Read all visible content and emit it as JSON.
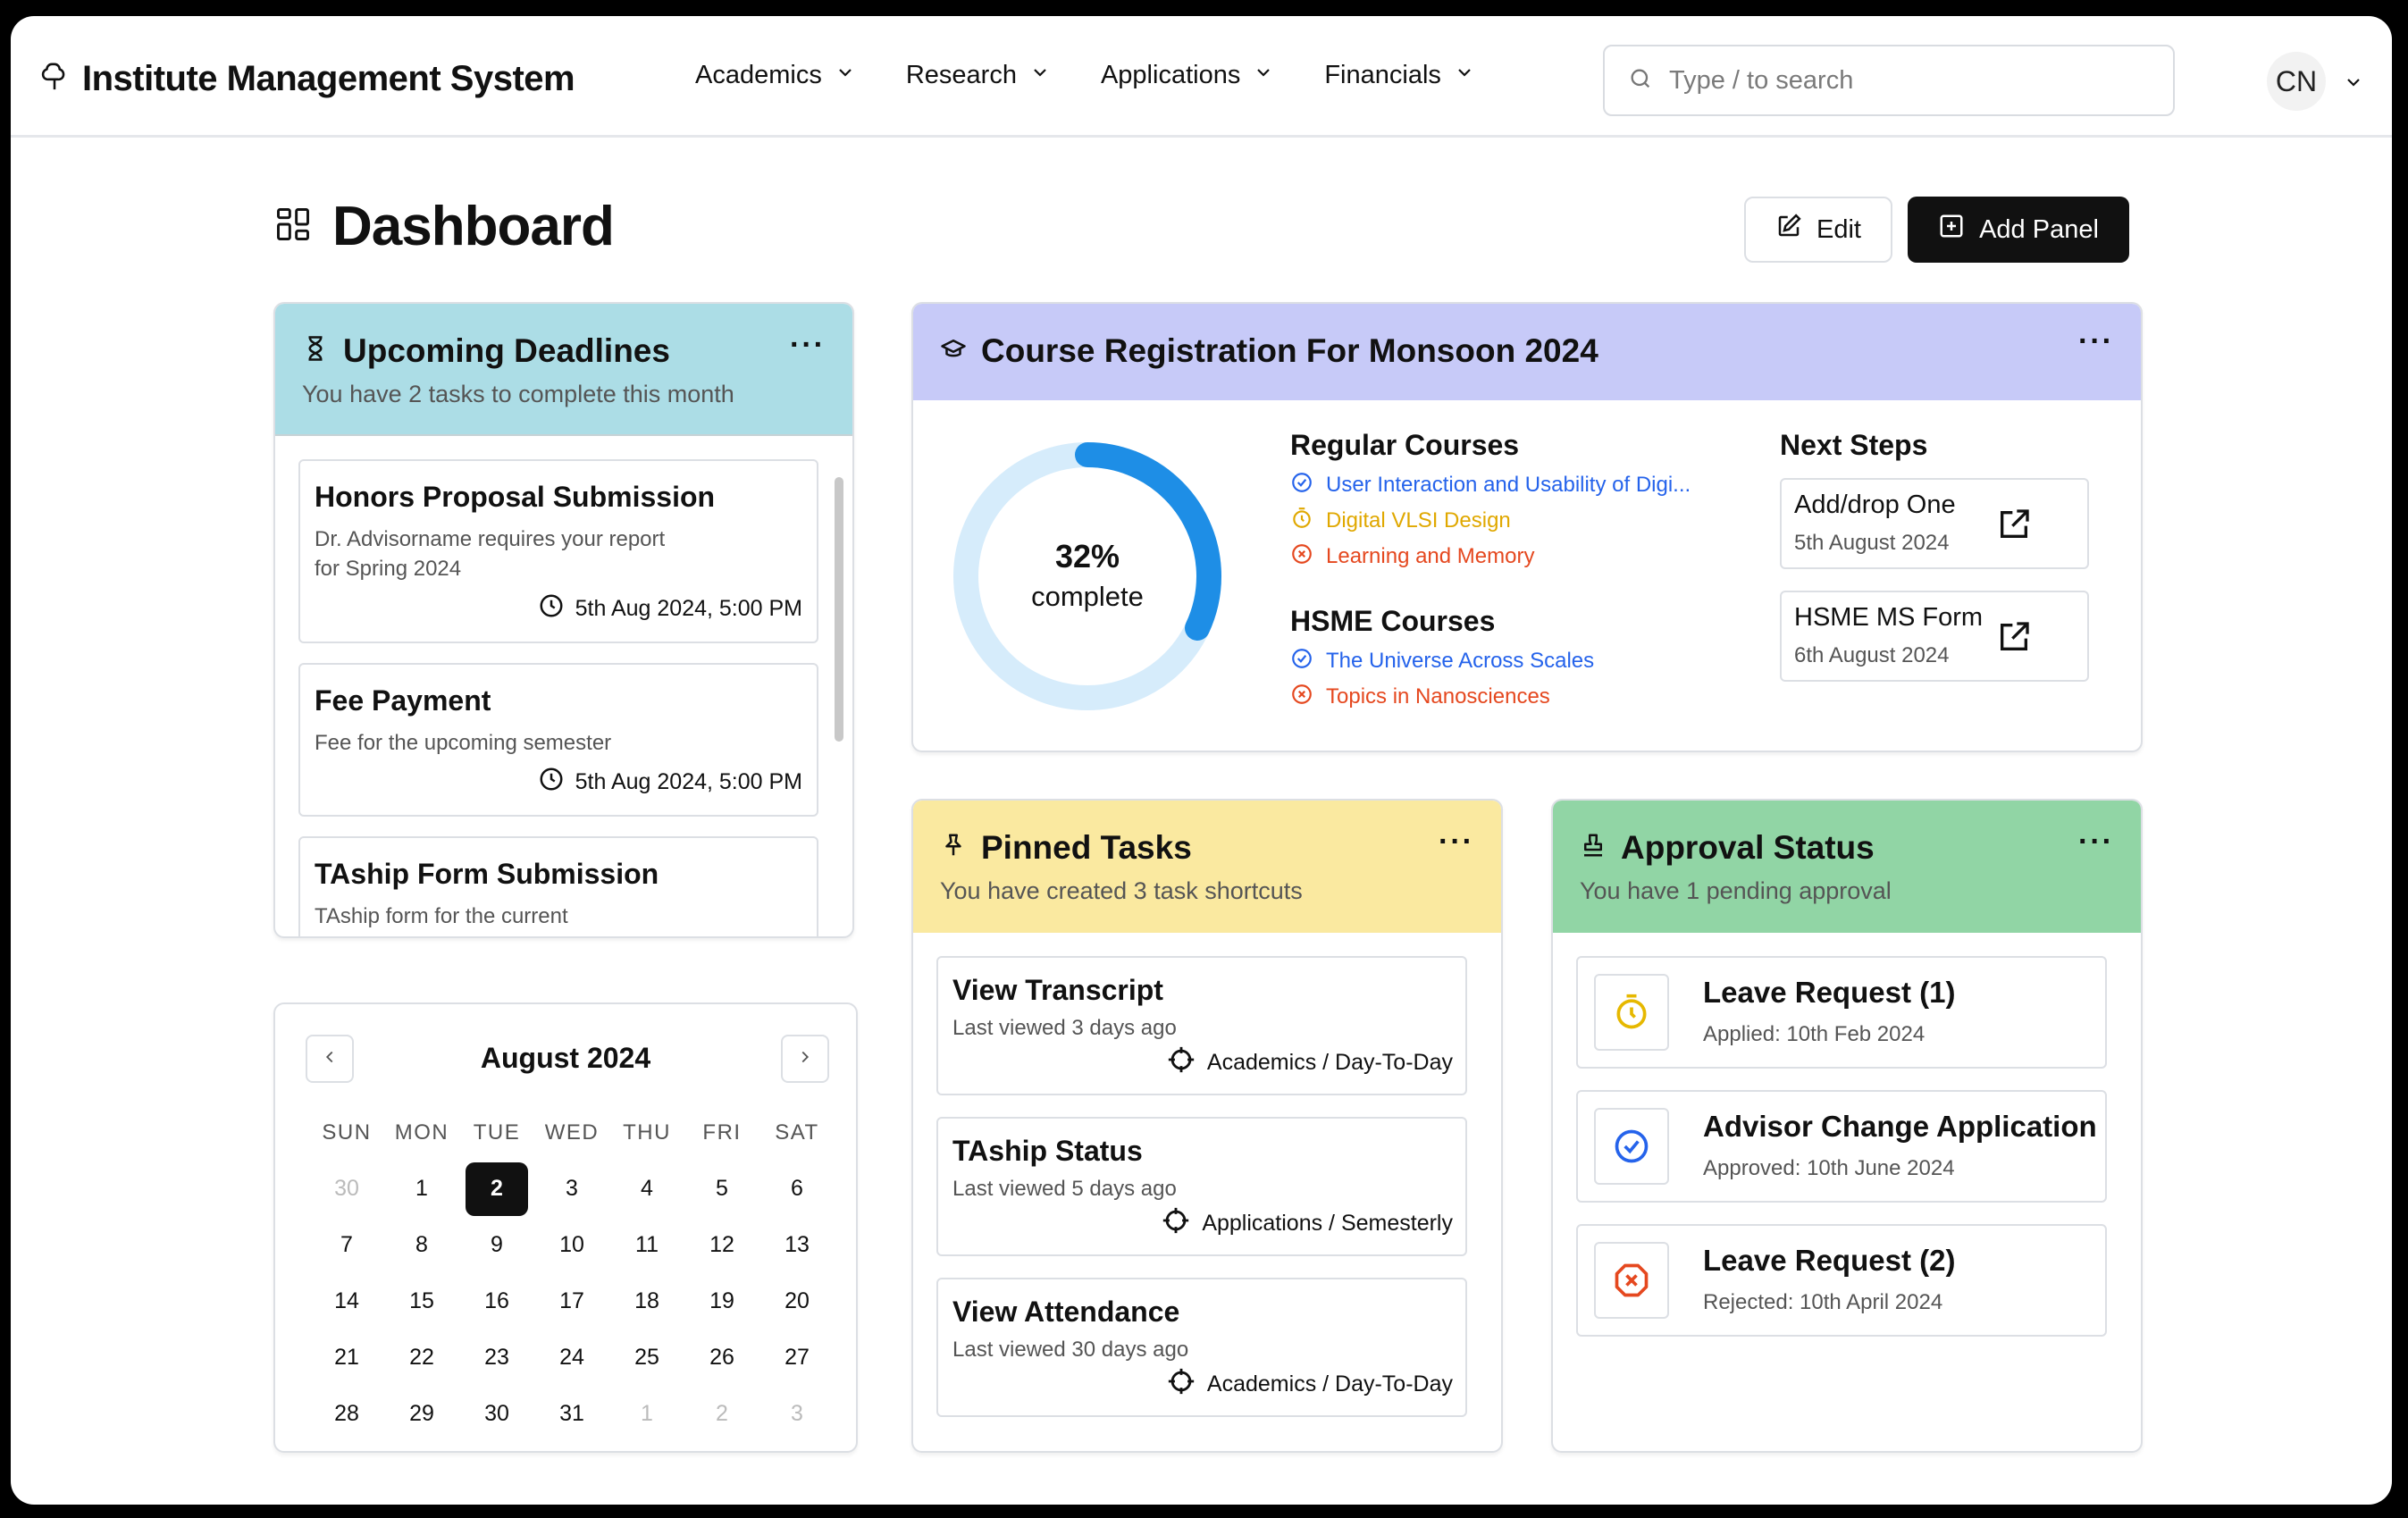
{
  "app": {
    "title": "Institute Management System"
  },
  "nav": {
    "items": [
      {
        "label": "Academics"
      },
      {
        "label": "Research"
      },
      {
        "label": "Applications"
      },
      {
        "label": "Financials"
      }
    ],
    "search_placeholder": "Type / to search",
    "avatar_initials": "CN"
  },
  "page": {
    "title": "Dashboard",
    "edit_label": "Edit",
    "add_panel_label": "Add Panel"
  },
  "deadlines": {
    "title": "Upcoming Deadlines",
    "subtitle": "You have 2 tasks to complete this month",
    "items": [
      {
        "title": "Honors Proposal Submission",
        "desc": "Dr. Advisorname requires your report for Spring 2024",
        "due": "5th Aug 2024, 5:00 PM"
      },
      {
        "title": "Fee Payment",
        "desc": "Fee for the upcoming semester",
        "due": "5th Aug 2024, 5:00 PM"
      },
      {
        "title": "TAship Form Submission",
        "desc": "TAship form for the current",
        "due": ""
      }
    ]
  },
  "calendar": {
    "title": "August 2024",
    "weekdays": [
      "SUN",
      "MON",
      "TUE",
      "WED",
      "THU",
      "FRI",
      "SAT"
    ],
    "weeks": [
      [
        "30",
        "1",
        "2",
        "3",
        "4",
        "5",
        "6"
      ],
      [
        "7",
        "8",
        "9",
        "10",
        "11",
        "12",
        "13"
      ],
      [
        "14",
        "15",
        "16",
        "17",
        "18",
        "19",
        "20"
      ],
      [
        "21",
        "22",
        "23",
        "24",
        "25",
        "26",
        "27"
      ],
      [
        "28",
        "29",
        "30",
        "31",
        "1",
        "2",
        "3"
      ]
    ],
    "selected": "2"
  },
  "course": {
    "title": "Course Registration For Monsoon 2024",
    "progress_percent": 32,
    "progress_label": "32%",
    "progress_text": "complete",
    "regular_title": "Regular Courses",
    "regular": [
      {
        "name": "User Interaction and Usability of Digi...",
        "status": "registered"
      },
      {
        "name": "Digital VLSI Design",
        "status": "pending"
      },
      {
        "name": "Learning and Memory",
        "status": "rejected"
      }
    ],
    "hsme_title": "HSME Courses",
    "hsme": [
      {
        "name": "The Universe Across Scales",
        "status": "registered"
      },
      {
        "name": "Topics in Nanosciences",
        "status": "rejected"
      }
    ],
    "next_title": "Next Steps",
    "next": [
      {
        "title": "Add/drop One",
        "date": "5th August 2024"
      },
      {
        "title": "HSME MS Form",
        "date": "6th August 2024"
      }
    ]
  },
  "pinned": {
    "title": "Pinned Tasks",
    "subtitle": "You have created 3 task shortcuts",
    "items": [
      {
        "title": "View Transcript",
        "desc": "Last viewed 3 days ago",
        "category": "Academics / Day-To-Day"
      },
      {
        "title": "TAship Status",
        "desc": "Last viewed 5 days ago",
        "category": "Applications / Semesterly"
      },
      {
        "title": "View Attendance",
        "desc": "Last viewed 30 days ago",
        "category": "Academics / Day-To-Day"
      }
    ]
  },
  "approval": {
    "title": "Approval Status",
    "subtitle": "You have 1 pending approval",
    "items": [
      {
        "title": "Leave Request (1)",
        "desc": "Applied: 10th Feb 2024",
        "status": "pending"
      },
      {
        "title": "Advisor Change Application",
        "desc": "Approved: 10th June 2024",
        "status": "approved"
      },
      {
        "title": "Leave Request (2)",
        "desc": "Rejected: 10th April 2024",
        "status": "rejected"
      }
    ]
  },
  "colors": {
    "deadlines_header": "#acdde6",
    "course_header": "#c7caf8",
    "pinned_header": "#fae9a0",
    "approval_header": "#91d5a5",
    "registered": "#2563eb",
    "pending": "#e0a800",
    "rejected": "#e5481f",
    "donut_fill": "#1e8ee6",
    "donut_track": "#d6ecfb"
  }
}
